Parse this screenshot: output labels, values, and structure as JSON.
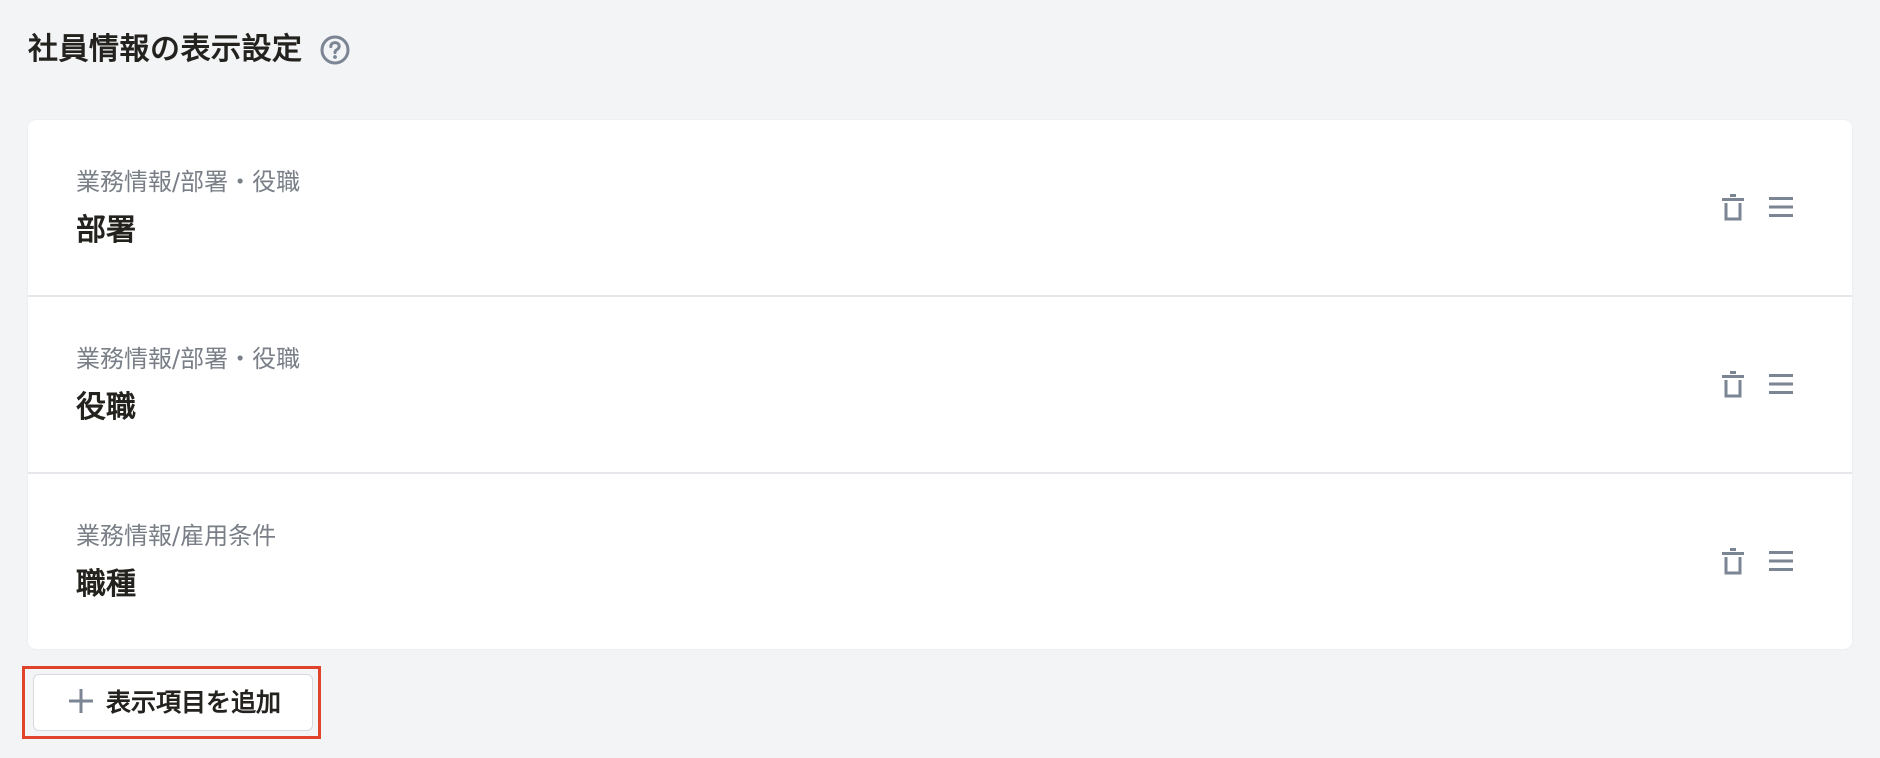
{
  "header": {
    "title": "社員情報の表示設定",
    "help_icon": "question-circle-icon"
  },
  "fields": [
    {
      "category": "業務情報/部署・役職",
      "name": "部署"
    },
    {
      "category": "業務情報/部署・役職",
      "name": "役職"
    },
    {
      "category": "業務情報/雇用条件",
      "name": "職種"
    }
  ],
  "row_icons": {
    "delete": "trash-icon",
    "drag": "drag-handle-icon"
  },
  "add_button": {
    "label": "表示項目を追加",
    "icon": "plus-icon"
  },
  "colors": {
    "background": "#f3f4f6",
    "card": "#ffffff",
    "icon": "#7b8593",
    "highlight": "#e0422b"
  }
}
